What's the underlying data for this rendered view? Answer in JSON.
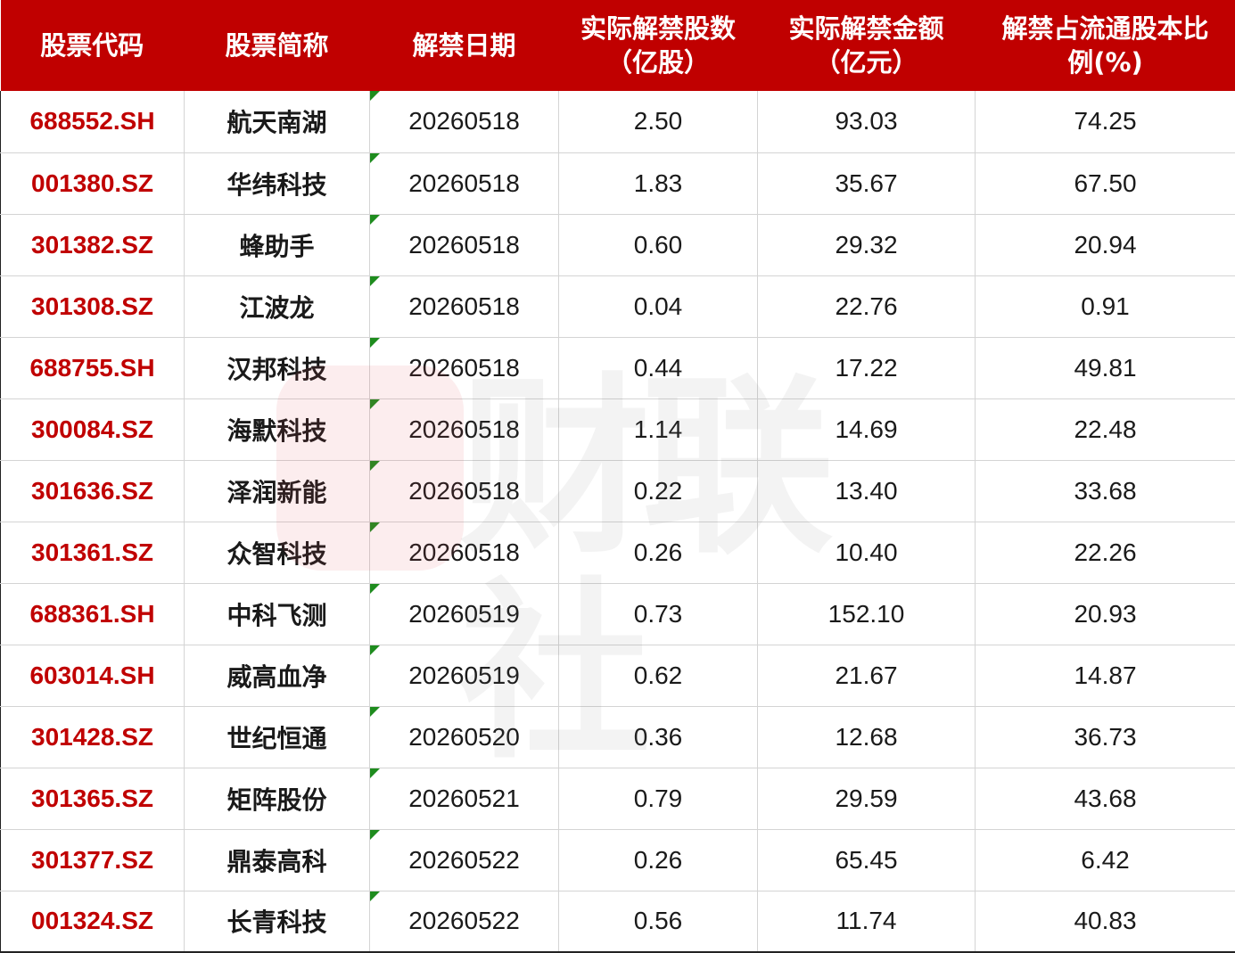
{
  "headers": [
    "股票代码",
    "股票简称",
    "解禁日期",
    "实际解禁股数\n（亿股）",
    "实际解禁金额\n（亿元）",
    "解禁占流通股本比\n例(%)"
  ],
  "rows": [
    {
      "code": "688552.SH",
      "name": "航天南湖",
      "date": "20260518",
      "shares": "2.50",
      "amount": "93.03",
      "ratio": "74.25"
    },
    {
      "code": "001380.SZ",
      "name": "华纬科技",
      "date": "20260518",
      "shares": "1.83",
      "amount": "35.67",
      "ratio": "67.50"
    },
    {
      "code": "301382.SZ",
      "name": "蜂助手",
      "date": "20260518",
      "shares": "0.60",
      "amount": "29.32",
      "ratio": "20.94"
    },
    {
      "code": "301308.SZ",
      "name": "江波龙",
      "date": "20260518",
      "shares": "0.04",
      "amount": "22.76",
      "ratio": "0.91"
    },
    {
      "code": "688755.SH",
      "name": "汉邦科技",
      "date": "20260518",
      "shares": "0.44",
      "amount": "17.22",
      "ratio": "49.81"
    },
    {
      "code": "300084.SZ",
      "name": "海默科技",
      "date": "20260518",
      "shares": "1.14",
      "amount": "14.69",
      "ratio": "22.48"
    },
    {
      "code": "301636.SZ",
      "name": "泽润新能",
      "date": "20260518",
      "shares": "0.22",
      "amount": "13.40",
      "ratio": "33.68"
    },
    {
      "code": "301361.SZ",
      "name": "众智科技",
      "date": "20260518",
      "shares": "0.26",
      "amount": "10.40",
      "ratio": "22.26"
    },
    {
      "code": "688361.SH",
      "name": "中科飞测",
      "date": "20260519",
      "shares": "0.73",
      "amount": "152.10",
      "ratio": "20.93"
    },
    {
      "code": "603014.SH",
      "name": "威高血净",
      "date": "20260519",
      "shares": "0.62",
      "amount": "21.67",
      "ratio": "14.87"
    },
    {
      "code": "301428.SZ",
      "name": "世纪恒通",
      "date": "20260520",
      "shares": "0.36",
      "amount": "12.68",
      "ratio": "36.73"
    },
    {
      "code": "301365.SZ",
      "name": "矩阵股份",
      "date": "20260521",
      "shares": "0.79",
      "amount": "29.59",
      "ratio": "43.68"
    },
    {
      "code": "301377.SZ",
      "name": "鼎泰高科",
      "date": "20260522",
      "shares": "0.26",
      "amount": "65.45",
      "ratio": "6.42"
    },
    {
      "code": "001324.SZ",
      "name": "长青科技",
      "date": "20260522",
      "shares": "0.56",
      "amount": "11.74",
      "ratio": "40.83"
    }
  ],
  "watermark": "财联社",
  "colors": {
    "header_bg": "#c00000",
    "header_text": "#ffffff",
    "code_text": "#c00000",
    "marker": "#1e8c1e"
  }
}
